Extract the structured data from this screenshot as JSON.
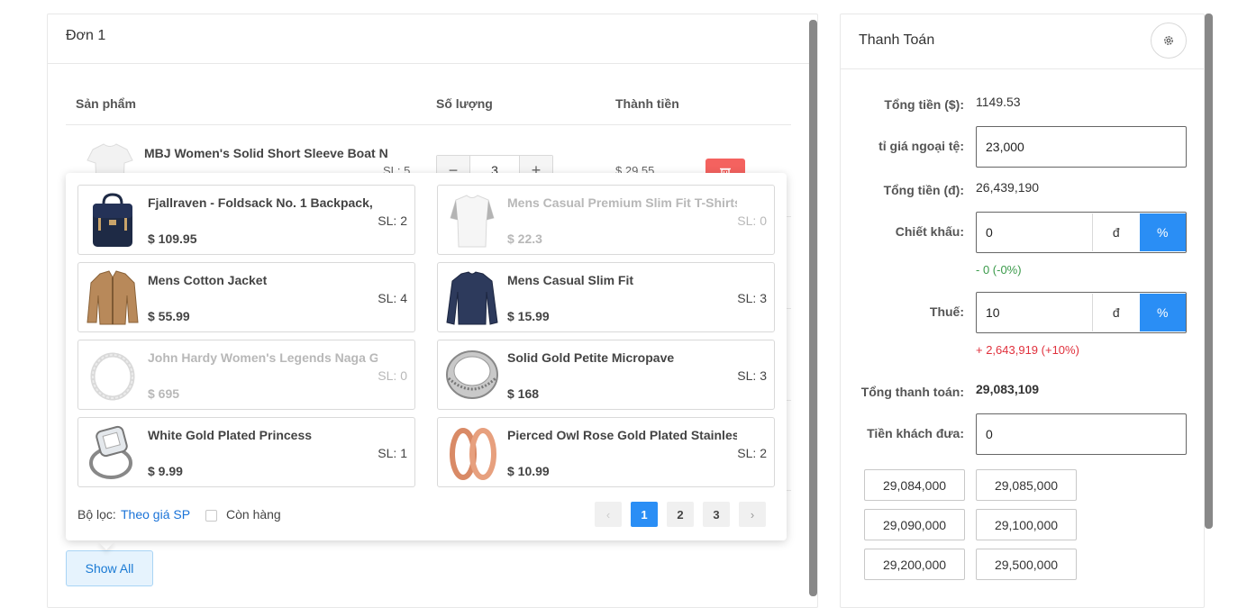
{
  "order": {
    "title": "Đơn 1",
    "columns": {
      "product": "Sản phẩm",
      "quantity": "Số lượng",
      "total": "Thành tiền"
    },
    "row": {
      "name": "MBJ Women's Solid Short Sleeve Boat N",
      "stock": "SL: 5",
      "qty": "3",
      "price": "$ 29.55"
    },
    "show_all": "Show All"
  },
  "popover": {
    "products": [
      {
        "name": "Fjallraven - Foldsack No. 1 Backpack,",
        "stock": "SL: 2",
        "price": "$ 109.95",
        "icon": "backpack"
      },
      {
        "name": "Mens Casual Premium Slim Fit T-Shirts",
        "stock": "SL: 0",
        "price": "$ 22.3",
        "icon": "tshirt"
      },
      {
        "name": "Mens Cotton Jacket",
        "stock": "SL: 4",
        "price": "$ 55.99",
        "icon": "jacket"
      },
      {
        "name": "Mens Casual Slim Fit",
        "stock": "SL: 3",
        "price": "$ 15.99",
        "icon": "longsleeve"
      },
      {
        "name": "John Hardy Women's Legends Naga Gold",
        "stock": "SL: 0",
        "price": "$ 695",
        "icon": "bracelet"
      },
      {
        "name": "Solid Gold Petite Micropave",
        "stock": "SL: 3",
        "price": "$ 168",
        "icon": "ring"
      },
      {
        "name": "White Gold Plated Princess",
        "stock": "SL: 1",
        "price": "$ 9.99",
        "icon": "diamond-ring"
      },
      {
        "name": "Pierced Owl Rose Gold Plated Stainless",
        "stock": "SL: 2",
        "price": "$ 10.99",
        "icon": "rose-rings"
      }
    ],
    "filter_label": "Bộ lọc:",
    "filter_link": "Theo giá SP",
    "in_stock_label": "Còn hàng",
    "pages": [
      "1",
      "2",
      "3"
    ],
    "prev": "‹",
    "next": "›"
  },
  "payment": {
    "title": "Thanh Toán",
    "total_usd_label": "Tổng tiền ($):",
    "total_usd": "1149.53",
    "rate_label": "tỉ giá ngoại tệ:",
    "rate": "23,000",
    "total_vnd_label": "Tổng tiền (đ):",
    "total_vnd": "26,439,190",
    "discount_label": "Chiết khấu:",
    "discount": "0",
    "unit_d": "đ",
    "unit_pct": "%",
    "discount_note": "- 0 (-0%)",
    "tax_label": "Thuế:",
    "tax": "10",
    "tax_note": "+ 2,643,919 (+10%)",
    "grand_label": "Tổng thanh toán:",
    "grand": "29,083,109",
    "paid_label": "Tiền khách đưa:",
    "paid": "0",
    "quick_amounts": [
      "29,084,000",
      "29,085,000",
      "29,090,000",
      "29,100,000",
      "29,200,000",
      "29,500,000"
    ]
  },
  "colors": {
    "primary": "#2a8ef5",
    "danger": "#f4625f",
    "success": "#3a9a4a",
    "error": "#e0303c"
  }
}
